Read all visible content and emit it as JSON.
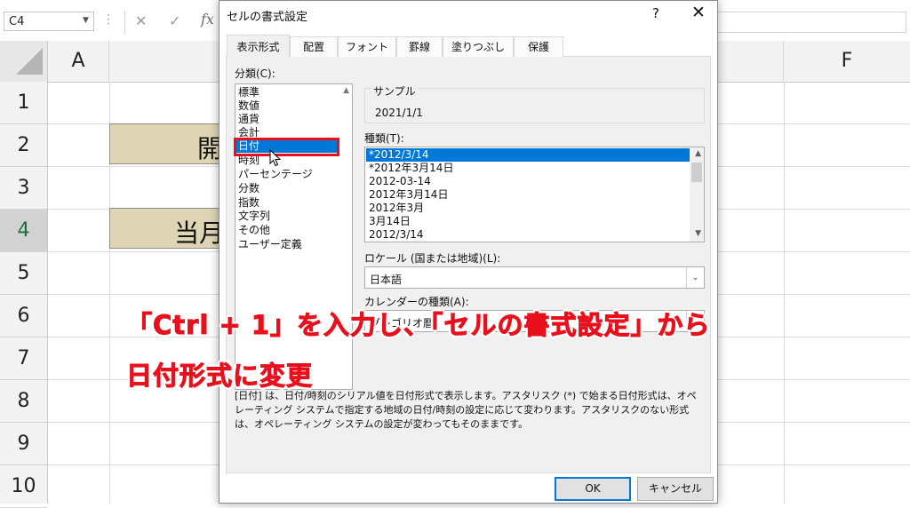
{
  "formula_bar": {
    "name_box": "C4",
    "cancel_icon": "✕",
    "enter_icon": "✓",
    "fx_label": "fx"
  },
  "sheet": {
    "columns": [
      "A",
      "F"
    ],
    "rows": [
      "1",
      "2",
      "3",
      "4",
      "5",
      "6",
      "7",
      "8",
      "9",
      "10"
    ],
    "selected_row": "4",
    "cell_b2": "開",
    "cell_b4": "当月",
    "cell_fill_color": "#ddd5b3"
  },
  "dialog": {
    "title": "セルの書式設定",
    "help_label": "?",
    "close_label": "✕",
    "tabs": [
      "表示形式",
      "配置",
      "フォント",
      "罫線",
      "塗りつぶし",
      "保護"
    ],
    "active_tab": "表示形式",
    "category_label": "分類(C):",
    "categories": [
      "標準",
      "数値",
      "通貨",
      "会計",
      "日付",
      "時刻",
      "パーセンテージ",
      "分数",
      "指数",
      "文字列",
      "その他",
      "ユーザー定義"
    ],
    "selected_category": "日付",
    "sample_label": "サンプル",
    "sample_value": "2021/1/1",
    "type_label": "種類(T):",
    "types": [
      "*2012/3/14",
      "*2012年3月14日",
      "2012-03-14",
      "2012年3月14日",
      "2012年3月",
      "3月14日",
      "2012/3/14"
    ],
    "selected_type": "*2012/3/14",
    "locale_label": "ロケール (国または地域)(L):",
    "locale_value": "日本語",
    "calendar_label": "カレンダーの種類(A):",
    "calendar_value": "グレゴリオ暦",
    "description": "[日付] は、日付/時刻のシリアル値を日付形式で表示します。アスタリスク (*) で始まる日付形式は、オペレーティング システムで指定する地域の日付/時刻の設定に応じて変わります。アスタリスクのない形式は、オペレーティング システムの設定が変わってもそのままです。",
    "ok_label": "OK",
    "cancel_label": "キャンセル",
    "accent_color": "#0078d7"
  },
  "overlay": {
    "caption_line1": "「Ctrl + 1」を入力し、「セルの書式設定」から",
    "caption_line2": "日付形式に変更",
    "caption_color": "#e8101c"
  }
}
